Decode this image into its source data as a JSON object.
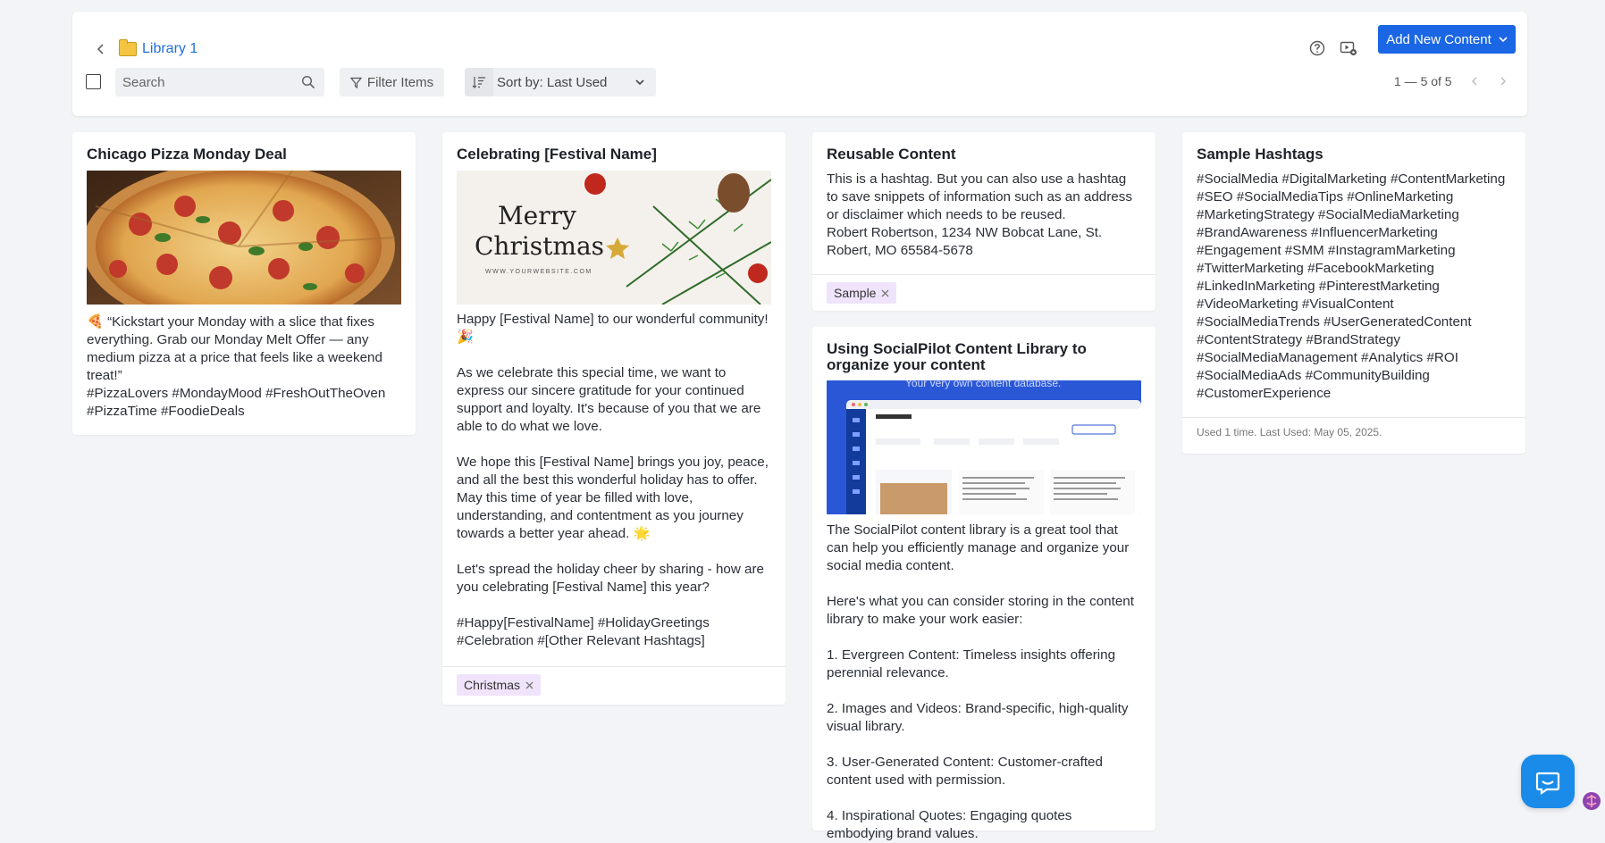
{
  "header": {
    "breadcrumb_label": "Library 1",
    "add_button_label": "Add New Content",
    "search_placeholder": "Search",
    "filter_label": "Filter Items",
    "sort_label": "Sort by: Last Used",
    "pagination": "1 — 5 of 5"
  },
  "icons": {
    "back": "chevron-left-icon",
    "folder": "folder-icon",
    "help": "help-circle-icon",
    "video": "video-settings-icon",
    "search": "search-icon",
    "filter": "filter-icon",
    "sort": "sort-icon",
    "chat": "chat-bubble-icon"
  },
  "colors": {
    "accent": "#1a66e5",
    "tag_bg": "#efe4fb",
    "background": "#f3f4f7"
  },
  "cards": [
    {
      "title": "Chicago Pizza Monday Deal",
      "body": "🍕 “Kickstart your Monday with a slice that fixes everything. Grab our Monday Melt Offer — any medium pizza at a price that feels like a weekend treat!”\n#PizzaLovers #MondayMood #FreshOutTheOven #PizzaTime #FoodieDeals"
    },
    {
      "title": "Celebrating [Festival Name]",
      "image_text_1": "Merry",
      "image_text_2": "Christmas",
      "image_text_3": "WWW.YOURWEBSITE.COM",
      "body": "Happy [Festival Name] to our wonderful community! 🎉\n\nAs we celebrate this special time, we want to express our sincere gratitude for your continued support and loyalty. It's because of you that we are able to do what we love.\n\nWe hope this [Festival Name] brings you joy, peace, and all the best this wonderful holiday has to offer. May this time of year be filled with love, understanding, and contentment as you journey towards a better year ahead. 🌟\n\nLet's spread the holiday cheer by sharing - how are you celebrating [Festival Name] this year?\n\n#Happy[FestivalName] #HolidayGreetings #Celebration #[Other Relevant Hashtags]",
      "tag": "Christmas"
    },
    {
      "title": "Reusable Content",
      "body": "This is a hashtag. But you can also use a hashtag to save snippets of information such as an address or disclaimer which needs to be reused.\nRobert Robertson, 1234 NW Bobcat Lane, St. Robert, MO 65584-5678",
      "tag": "Sample"
    },
    {
      "title": "Using SocialPilot Content Library to organize your content",
      "image_caption": "Your very own content database.",
      "body": "The SocialPilot content library is a great tool that can help you efficiently manage and organize your social media content.\n\nHere's what you can consider storing in the content library to make your work easier:\n\n1. Evergreen Content: Timeless insights offering perennial relevance.\n\n2. Images and Videos: Brand-specific, high-quality visual library.\n\n3. User-Generated Content: Customer-crafted content used with permission.\n\n4. Inspirational Quotes: Engaging quotes embodying brand values."
    },
    {
      "title": "Sample Hashtags",
      "body": "#SocialMedia #DigitalMarketing #ContentMarketing #SEO #SocialMediaTips #OnlineMarketing #MarketingStrategy #SocialMediaMarketing #BrandAwareness #InfluencerMarketing #Engagement #SMM #InstagramMarketing #TwitterMarketing #FacebookMarketing #LinkedInMarketing #PinterestMarketing #VideoMarketing #VisualContent #SocialMediaTrends #UserGeneratedContent #ContentStrategy #BrandStrategy #SocialMediaManagement #Analytics #ROI #SocialMediaAds #CommunityBuilding #CustomerExperience",
      "meta": "Used 1 time. Last Used: May 05, 2025."
    }
  ]
}
